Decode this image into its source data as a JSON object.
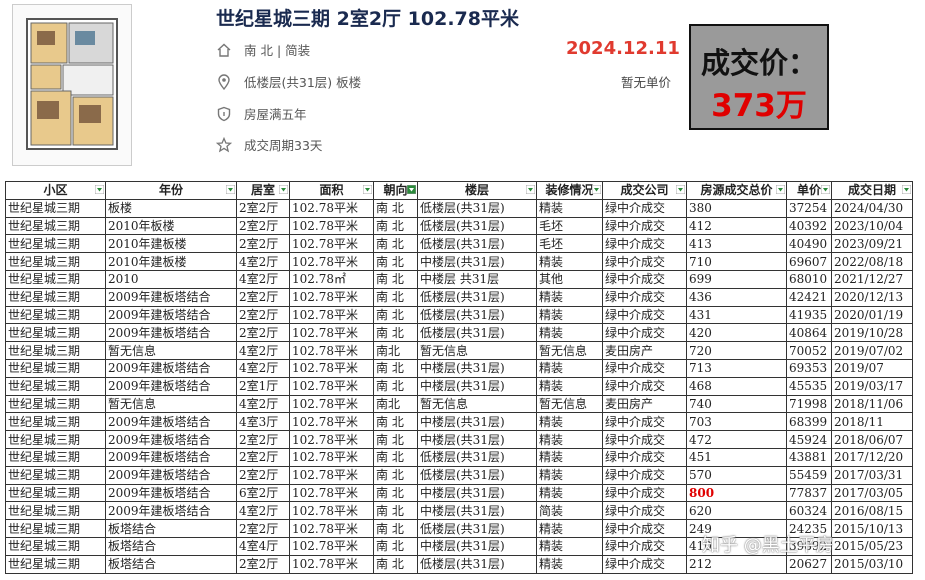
{
  "listing": {
    "title": "世纪星城三期 2室2厅 102.78平米",
    "orientation": "南 北 | 简装",
    "floor": "低楼层(共31层) 板楼",
    "ownership": "房屋满五年",
    "cycle": "成交周期33天",
    "deal_date": "2024.12.11",
    "unit_price": "暂无单价",
    "price_label": "成交价：",
    "price_value": "373万"
  },
  "table": {
    "headers": [
      "小区",
      "年份",
      "居室",
      "面积",
      "朝向",
      "楼层",
      "装修情况",
      "成交公司",
      "房源成交总价",
      "单价",
      "成交日期"
    ],
    "rows": [
      [
        "世纪星城三期",
        "板楼",
        "2室2厅",
        "102.78平米",
        "南 北",
        "低楼层(共31层)",
        "精装",
        "绿中介成交",
        "380",
        "37254",
        "2024/04/30"
      ],
      [
        "世纪星城三期",
        "2010年板楼",
        "2室2厅",
        "102.78平米",
        "南 北",
        "低楼层(共31层)",
        "毛坯",
        "绿中介成交",
        "412",
        "40392",
        "2023/10/04"
      ],
      [
        "世纪星城三期",
        "2010年建板楼",
        "2室2厅",
        "102.78平米",
        "南 北",
        "低楼层(共31层)",
        "毛坯",
        "绿中介成交",
        "413",
        "40490",
        "2023/09/21"
      ],
      [
        "世纪星城三期",
        "2010年建板楼",
        "4室2厅",
        "102.78平米",
        "南 北",
        "中楼层(共31层)",
        "精装",
        "绿中介成交",
        "710",
        "69607",
        "2022/08/18"
      ],
      [
        "世纪星城三期",
        "2010",
        "4室2厅",
        "102.78㎡",
        "南 北",
        "中楼层 共31层",
        "其他",
        "绿中介成交",
        "699",
        "68010",
        "2021/12/27"
      ],
      [
        "世纪星城三期",
        "2009年建板塔结合",
        "2室2厅",
        "102.78平米",
        "南 北",
        "低楼层(共31层)",
        "精装",
        "绿中介成交",
        "436",
        "42421",
        "2020/12/13"
      ],
      [
        "世纪星城三期",
        "2009年建板塔结合",
        "2室2厅",
        "102.78平米",
        "南 北",
        "低楼层(共31层)",
        "精装",
        "绿中介成交",
        "431",
        "41935",
        "2020/01/19"
      ],
      [
        "世纪星城三期",
        "2009年建板塔结合",
        "2室2厅",
        "102.78平米",
        "南 北",
        "低楼层(共31层)",
        "精装",
        "绿中介成交",
        "420",
        "40864",
        "2019/10/28"
      ],
      [
        "世纪星城三期",
        "暂无信息",
        "4室2厅",
        "102.78平米",
        "南北",
        "暂无信息",
        "暂无信息",
        "麦田房产",
        "720",
        "70052",
        "2019/07/02"
      ],
      [
        "世纪星城三期",
        "2009年建板塔结合",
        "4室2厅",
        "102.78平米",
        "南 北",
        "中楼层(共31层)",
        "精装",
        "绿中介成交",
        "713",
        "69353",
        "2019/07"
      ],
      [
        "世纪星城三期",
        "2009年建板塔结合",
        "2室1厅",
        "102.78平米",
        "南 北",
        "中楼层(共31层)",
        "精装",
        "绿中介成交",
        "468",
        "45535",
        "2019/03/17"
      ],
      [
        "世纪星城三期",
        "暂无信息",
        "4室2厅",
        "102.78平米",
        "南北",
        "暂无信息",
        "暂无信息",
        "麦田房产",
        "740",
        "71998",
        "2018/11/06"
      ],
      [
        "世纪星城三期",
        "2009年建板塔结合",
        "4室3厅",
        "102.78平米",
        "南 北",
        "中楼层(共31层)",
        "精装",
        "绿中介成交",
        "703",
        "68399",
        "2018/11"
      ],
      [
        "世纪星城三期",
        "2009年建板塔结合",
        "2室2厅",
        "102.78平米",
        "南 北",
        "中楼层(共31层)",
        "精装",
        "绿中介成交",
        "472",
        "45924",
        "2018/06/07"
      ],
      [
        "世纪星城三期",
        "2009年建板塔结合",
        "2室2厅",
        "102.78平米",
        "南 北",
        "低楼层(共31层)",
        "精装",
        "绿中介成交",
        "451",
        "43881",
        "2017/12/20"
      ],
      [
        "世纪星城三期",
        "2009年建板塔结合",
        "2室2厅",
        "102.78平米",
        "南 北",
        "低楼层(共31层)",
        "精装",
        "绿中介成交",
        "570",
        "55459",
        "2017/03/31"
      ],
      [
        "世纪星城三期",
        "2009年建板塔结合",
        "6室2厅",
        "102.78平米",
        "南 北",
        "中楼层(共31层)",
        "精装",
        "绿中介成交",
        "800",
        "77837",
        "2017/03/05"
      ],
      [
        "世纪星城三期",
        "2009年建板塔结合",
        "4室2厅",
        "102.78平米",
        "南 北",
        "中楼层(共31层)",
        "简装",
        "绿中介成交",
        "620",
        "60324",
        "2016/08/15"
      ],
      [
        "世纪星城三期",
        "板塔结合",
        "2室2厅",
        "102.78平米",
        "南 北",
        "低楼层(共31层)",
        "精装",
        "绿中介成交",
        "249",
        "24235",
        "2015/10/13"
      ],
      [
        "世纪星城三期",
        "板塔结合",
        "4室4厅",
        "102.78平米",
        "南 北",
        "中楼层(共31层)",
        "精装",
        "绿中介成交",
        "410",
        "39892",
        "2015/05/23"
      ],
      [
        "世纪星城三期",
        "板塔结合",
        "2室2厅",
        "102.78平米",
        "南 北",
        "低楼层(共31层)",
        "精装",
        "绿中介成交",
        "212",
        "20627",
        "2015/03/10"
      ]
    ],
    "highlight": {
      "row": 16,
      "col": 8,
      "color": "#e00000"
    }
  },
  "watermark": "知乎 @黑土平房",
  "colors": {
    "title": "#1a2a4f",
    "date": "#e03a2f",
    "price": "#e00000",
    "price_box_bg": "#9a9a9a"
  },
  "icons": [
    "home-icon",
    "location-icon",
    "shield-icon",
    "star-icon",
    "filter-dropdown-icon"
  ]
}
